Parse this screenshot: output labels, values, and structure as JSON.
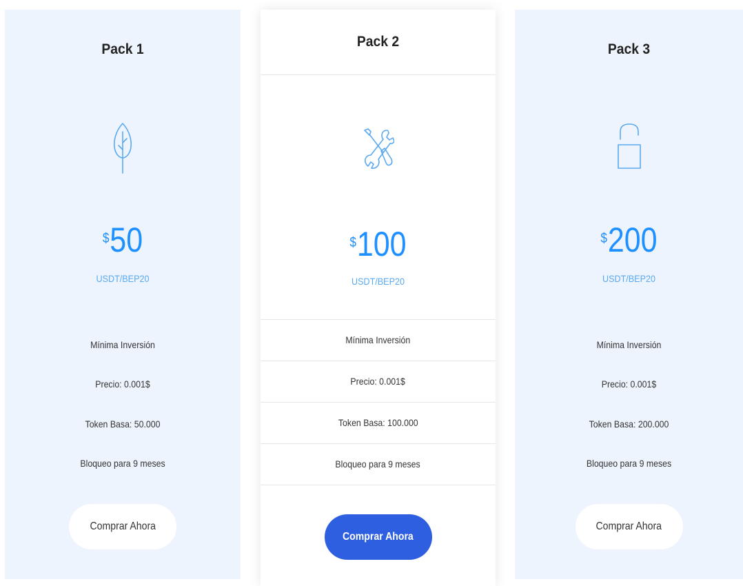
{
  "accent_color": "#1e90ff",
  "button_primary_color": "#2e5fe0",
  "packs": [
    {
      "title": "Pack 1",
      "icon": "leaf-icon",
      "currency_symbol": "$",
      "price": "50",
      "unit": "USDT/BEP20",
      "features": [
        "Mínima Inversión",
        "Precio: 0.001$",
        "Token Basa: 50.000",
        "Bloqueo para 9 meses"
      ],
      "button_label": "Comprar Ahora"
    },
    {
      "title": "Pack 2",
      "icon": "tools-icon",
      "currency_symbol": "$",
      "price": "100",
      "unit": "USDT/BEP20",
      "features": [
        "Mínima Inversión",
        "Precio: 0.001$",
        "Token Basa: 100.000",
        "Bloqueo para 9 meses"
      ],
      "button_label": "Comprar Ahora"
    },
    {
      "title": "Pack 3",
      "icon": "unlock-icon",
      "currency_symbol": "$",
      "price": "200",
      "unit": "USDT/BEP20",
      "features": [
        "Mínima Inversión",
        "Precio: 0.001$",
        "Token Basa: 200.000",
        "Bloqueo para 9 meses"
      ],
      "button_label": "Comprar Ahora"
    }
  ]
}
